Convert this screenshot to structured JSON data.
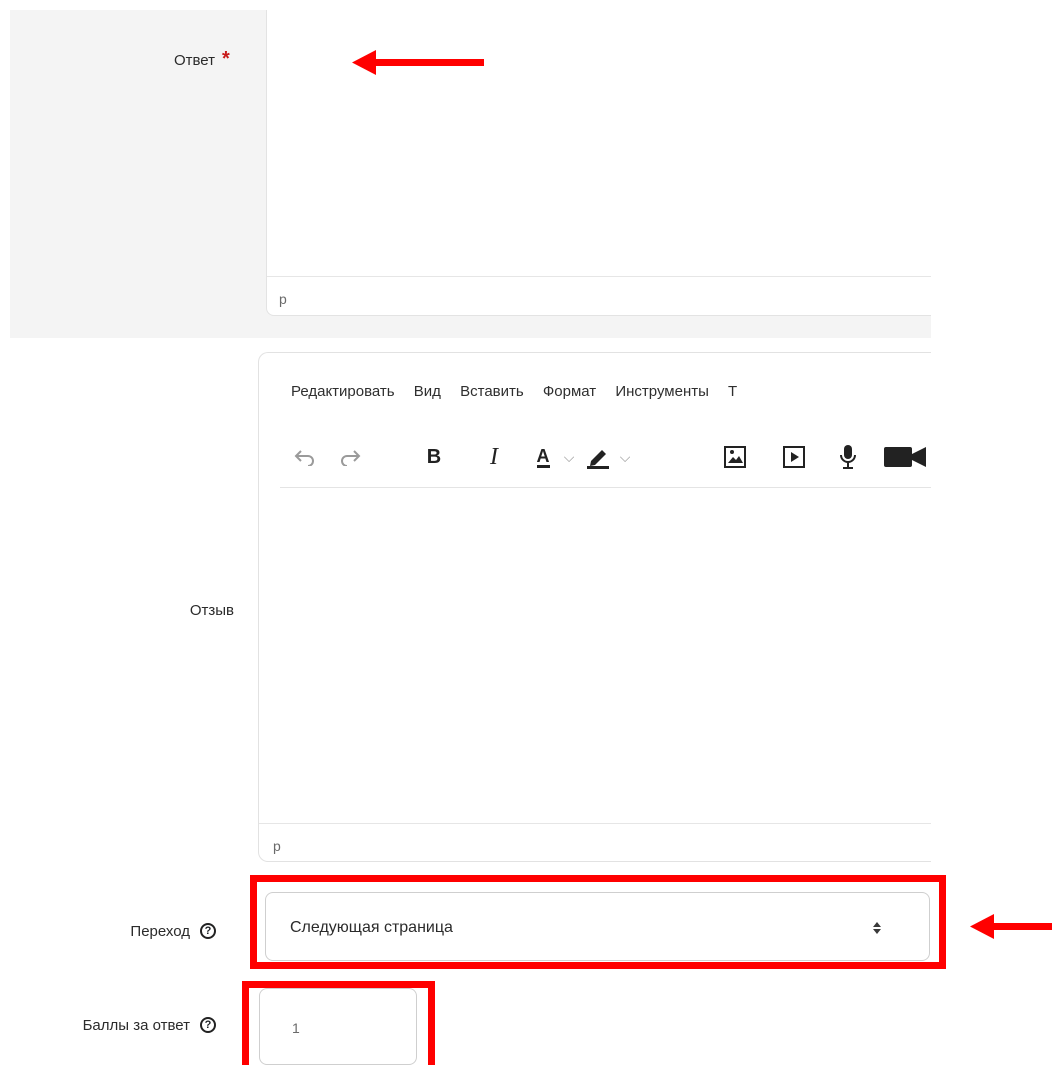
{
  "answer": {
    "label": "Ответ",
    "required_mark": "*",
    "status_path": "p"
  },
  "feedback": {
    "label": "Отзыв",
    "menu": [
      "Редактировать",
      "Вид",
      "Вставить",
      "Формат",
      "Инструменты",
      "Т"
    ],
    "toolbar": {
      "bold": "B",
      "italic": "I",
      "text_color": "A"
    },
    "status_path": "p"
  },
  "jump": {
    "label": "Переход",
    "help_glyph": "?",
    "selected": "Следующая страница"
  },
  "score": {
    "label": "Баллы за ответ",
    "help_glyph": "?",
    "value": "1"
  },
  "colors": {
    "annotation_red": "#ff0000",
    "required_red": "#c81a1a"
  },
  "icons": [
    "undo-icon",
    "redo-icon",
    "chevron-down-icon",
    "highlighter-icon",
    "image-icon",
    "media-icon",
    "microphone-icon",
    "video-camera-icon",
    "help-icon",
    "select-arrows-icon",
    "arrow-left-icon"
  ]
}
